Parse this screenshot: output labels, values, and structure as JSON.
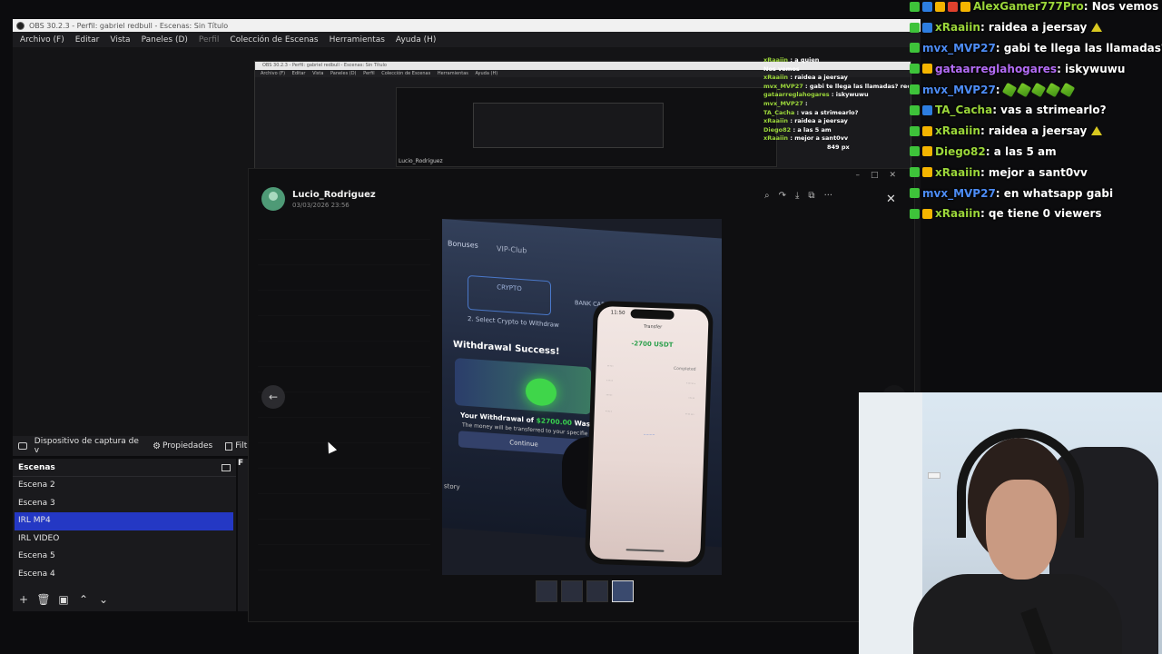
{
  "obs": {
    "title": "OBS 30.2.3 - Perfil: gabriel redbull - Escenas: Sin Título",
    "menu": [
      "Archivo (F)",
      "Editar",
      "Vista",
      "Paneles (D)",
      "Perfil",
      "Colección de Escenas",
      "Herramientas",
      "Ayuda (H)"
    ],
    "source_toolbar": {
      "source_name": "Dispositivo de captura de v",
      "properties": "Propiedades",
      "filters": "Filtr"
    },
    "scenes": {
      "header": "Escenas",
      "items": [
        "Escena 2",
        "Escena 3",
        "IRL MP4",
        "IRL VIDEO",
        "Escena 5",
        "Escena 4"
      ],
      "active_index": 2,
      "accent_color": "#2438c4"
    },
    "sources_header": "F"
  },
  "nested": {
    "title": "OBS 30.2.3 - Perfil: gabriel redbull - Escenas: Sin Título",
    "menu": [
      "Archivo (F)",
      "Editar",
      "Vista",
      "Paneles (D)",
      "Perfil",
      "Colección de Escenas",
      "Herramientas",
      "Ayuda (H)"
    ],
    "chat": [
      {
        "user": "xRaaiin",
        "text": " : a quien"
      },
      {
        "user": "",
        "text": "Nos vemos"
      },
      {
        "user": "xRaaiin",
        "text": " : raidea a jeersay"
      },
      {
        "user": "mvx_MVP27",
        "text": " : gabi te llega las llamadas? rec"
      },
      {
        "user": "gataarreglahogares",
        "text": " : iskywuwu"
      },
      {
        "user": "mvx_MVP27",
        "text": " : "
      },
      {
        "user": "TA_Cacha",
        "text": " : vas a strimearlo?"
      },
      {
        "user": "xRaaiin",
        "text": " : raidea a jeersay"
      },
      {
        "user": "Diego82",
        "text": " : a las 5 am"
      },
      {
        "user": "xRaaiin",
        "text": " : mejor a sant0vv"
      }
    ],
    "lucio": "Lucio_Rodriguez",
    "px_label": "849 px"
  },
  "viewer": {
    "username": "Lucio_Rodriguez",
    "date": "03/03/2026 23:56",
    "tools": [
      "zoom-icon",
      "forward-icon",
      "download-icon",
      "open-external-icon",
      "more-icon"
    ],
    "close_icon": "close-icon",
    "prev_icon": "arrow-left-icon",
    "photo": {
      "tab_bonuses": "Bonuses",
      "tab_vip": "VIP-Club",
      "crypto": "CRYPTO",
      "bank_card": "BANK CARD",
      "select_crypto": "2. Select Crypto to Withdraw",
      "withdraw_title": "Withdrawal Success!",
      "withdrawal_prefix": "Your Withdrawal of ",
      "withdrawal_amount": "$2700.00",
      "withdrawal_suffix": " Was Succe",
      "withdrawal_sub": "The money will be transferred to your specifie",
      "continue": "Continue",
      "history": "story",
      "phone_time": "11:50",
      "phone_title": "Transfer",
      "phone_amount": "-2700 USDT",
      "phone_status": "Completed"
    }
  },
  "chat": [
    {
      "badges": [
        "green",
        "blue",
        "yellow",
        "red",
        "yellow"
      ],
      "user": "AlexGamer777Pro",
      "color": "#9bd63a",
      "text": " : Nos vemos gor"
    },
    {
      "badges": [
        "green",
        "blue"
      ],
      "user": "xRaaiin",
      "color": "#9bd63a",
      "text": " : raidea a jeersay",
      "emote": "triangle"
    },
    {
      "badges": [
        "green"
      ],
      "user": "mvx_MVP27",
      "color": "#4d8cf5",
      "text": " : gabi te llega las llamadas? rec"
    },
    {
      "badges": [
        "green",
        "yellow"
      ],
      "user": "gataarreglahogares",
      "color": "#b36cf5",
      "text": " : iskywuwu"
    },
    {
      "badges": [
        "green"
      ],
      "user": "mvx_MVP27",
      "color": "#4d8cf5",
      "text": " : ",
      "emotes": 5
    },
    {
      "badges": [
        "green",
        "blue"
      ],
      "user": "TA_Cacha",
      "color": "#9bd63a",
      "text": " : vas a strimearlo?"
    },
    {
      "badges": [
        "green",
        "yellow"
      ],
      "user": "xRaaiin",
      "color": "#9bd63a",
      "text": " : raidea a jeersay",
      "emote": "triangle"
    },
    {
      "badges": [
        "green",
        "yellow"
      ],
      "user": "Diego82",
      "color": "#9bd63a",
      "text": " : a las 5 am"
    },
    {
      "badges": [
        "green",
        "yellow"
      ],
      "user": "xRaaiin",
      "color": "#9bd63a",
      "text": " : mejor a sant0vv"
    },
    {
      "badges": [
        "green"
      ],
      "user": "mvx_MVP27",
      "color": "#4d8cf5",
      "text": " : en whatsapp gabi"
    },
    {
      "badges": [
        "green",
        "yellow"
      ],
      "user": "xRaaiin",
      "color": "#9bd63a",
      "text": " : qe tiene 0 viewers"
    }
  ]
}
